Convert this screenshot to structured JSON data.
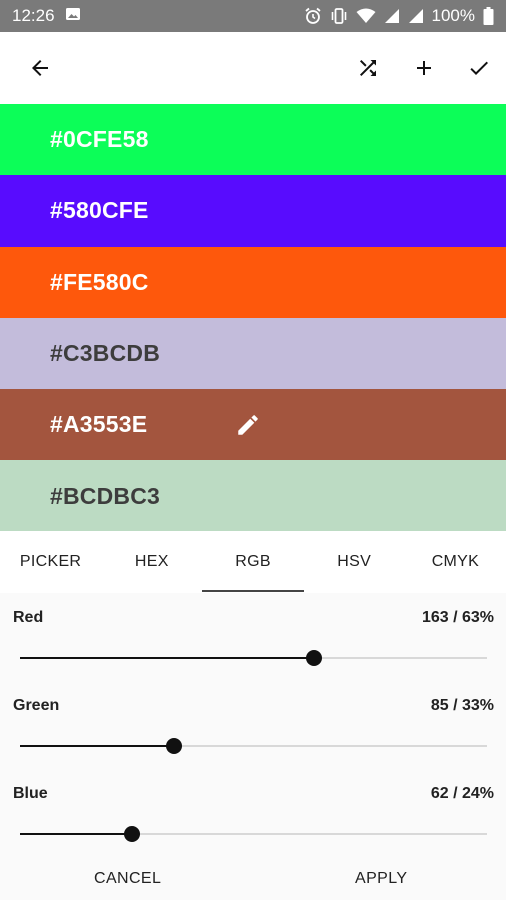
{
  "status_bar": {
    "time": "12:26",
    "battery": "100%",
    "icons": [
      "image-icon",
      "alarm-icon",
      "vibrate-icon",
      "wifi-icon",
      "signal-icon",
      "signal-icon",
      "battery-icon"
    ]
  },
  "toolbar": {
    "back_icon": "arrow-left-icon",
    "actions": [
      "shuffle-icon",
      "plus-icon",
      "check-icon"
    ]
  },
  "palette": {
    "swatches": [
      {
        "hex": "#0CFE58",
        "color": "#0CFE58",
        "text_color": "#ffffff",
        "selected": false
      },
      {
        "hex": "#580CFE",
        "color": "#580CFE",
        "text_color": "#ffffff",
        "selected": false
      },
      {
        "hex": "#FE580C",
        "color": "#FE580C",
        "text_color": "#ffffff",
        "selected": false
      },
      {
        "hex": "#C3BCDB",
        "color": "#C3BCDB",
        "text_color": "#3d3d3d",
        "selected": false
      },
      {
        "hex": "#A3553E",
        "color": "#A3553E",
        "text_color": "#ffffff",
        "selected": true
      },
      {
        "hex": "#BCDBC3",
        "color": "#BCDBC3",
        "text_color": "#3d3d3d",
        "selected": false
      }
    ],
    "edit_icon": "pencil-icon"
  },
  "tabs": {
    "items": [
      "PICKER",
      "HEX",
      "RGB",
      "HSV",
      "CMYK"
    ],
    "active": "RGB"
  },
  "sliders": [
    {
      "label": "Red",
      "value_text": "163 / 63%",
      "fraction": 0.63
    },
    {
      "label": "Green",
      "value_text": "85 / 33%",
      "fraction": 0.33
    },
    {
      "label": "Blue",
      "value_text": "62 / 24%",
      "fraction": 0.24
    }
  ],
  "actions": {
    "cancel": "CANCEL",
    "apply": "APPLY"
  }
}
